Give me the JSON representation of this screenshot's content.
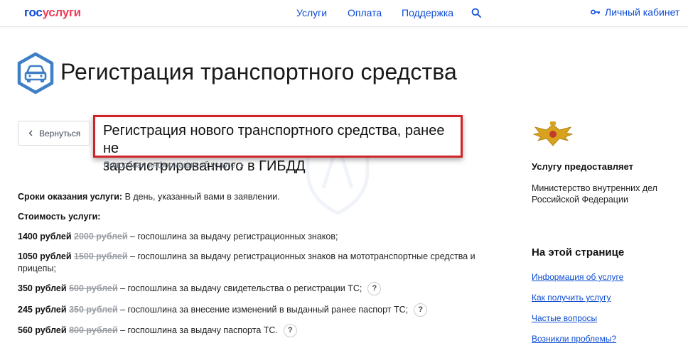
{
  "header": {
    "logo_part1": "гос",
    "logo_part2": "услуги",
    "nav": [
      "Услуги",
      "Оплата",
      "Поддержка"
    ],
    "cabinet_label": "Личный кабинет"
  },
  "page": {
    "title": "Регистрация транспортного средства",
    "back_label": "Вернуться",
    "subtitle_line1": "Регистрация нового транспортного средства, ранее не",
    "subtitle_line2": "зарегистрированного в ГИБДД",
    "more_info": "Подробная информация об услуге"
  },
  "terms": {
    "label": "Сроки оказания услуги:",
    "value": " В день, указанный вами в заявлении."
  },
  "cost": {
    "label": "Стоимость услуги:",
    "items": [
      {
        "price": "1400 рублей",
        "old": "2000 рублей",
        "desc": " – госпошлина за выдачу регистрационных знаков;",
        "help": ""
      },
      {
        "price": "1050 рублей",
        "old": "1500 рублей",
        "desc": " – госпошлина за выдачу регистрационных знаков на мототранспортные средства и",
        "desc2": "прицепы;",
        "help": ""
      },
      {
        "price": "350 рублей",
        "old": "500 рублей",
        "desc": " – госпошлина за выдачу свидетельства о регистрации ТС;",
        "help": "?"
      },
      {
        "price": "245 рублей",
        "old": "350 рублей",
        "desc": " – госпошлина за внесение изменений в выданный ранее паспорт ТС;",
        "help": "?"
      },
      {
        "price": "560 рублей",
        "old": "800 рублей",
        "desc": " – госпошлина за выдачу паспорта ТС.",
        "help": "?"
      }
    ]
  },
  "sidebar": {
    "provider_heading": "Услугу предоставляет",
    "provider_line1": "Министерство внутренних дел",
    "provider_line2": "Российской Федерации",
    "toc_heading": "На этой странице",
    "toc": [
      "Информация об услуге",
      "Как получить услугу",
      "Частые вопросы",
      "Возникли проблемы?"
    ]
  },
  "colors": {
    "brand_blue": "#0d4cd3",
    "brand_red": "#ee3f58",
    "highlight_border": "#d02428"
  }
}
